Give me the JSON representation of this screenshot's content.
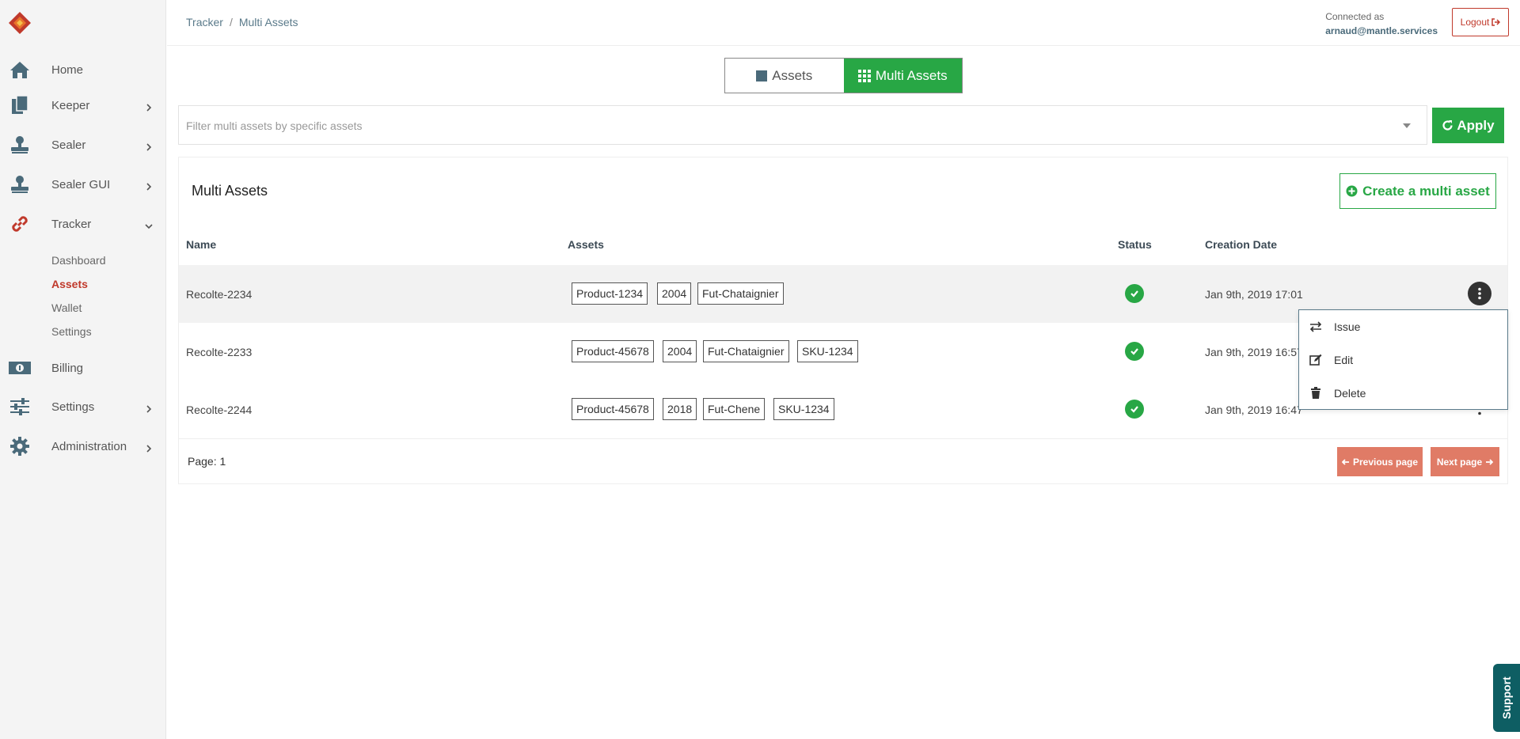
{
  "sidebar": {
    "logo": "mantle-logo",
    "items": [
      {
        "label": "Home",
        "icon": "home-icon"
      },
      {
        "label": "Keeper",
        "icon": "documents-icon"
      },
      {
        "label": "Sealer",
        "icon": "stamp-icon"
      },
      {
        "label": "Sealer GUI",
        "icon": "stamp-icon"
      },
      {
        "label": "Tracker",
        "icon": "link-icon"
      },
      {
        "label": "Billing",
        "icon": "money-icon"
      },
      {
        "label": "Settings",
        "icon": "sliders-icon"
      },
      {
        "label": "Administration",
        "icon": "gear-icon"
      }
    ],
    "tracker_sub": [
      "Dashboard",
      "Assets",
      "Wallet",
      "Settings"
    ],
    "active_sub": "Assets"
  },
  "header": {
    "breadcrumb": [
      "Tracker",
      "Multi Assets"
    ],
    "connected_as_label": "Connected as",
    "user": "arnaud@mantle.services",
    "logout_label": "Logout"
  },
  "toggle": {
    "assets_label": "Assets",
    "multi_label": "Multi Assets",
    "active": "Multi Assets"
  },
  "filter": {
    "placeholder": "Filter multi assets by specific assets",
    "apply_label": "Apply"
  },
  "panel": {
    "title": "Multi Assets",
    "create_label": "Create a multi asset",
    "columns": [
      "Name",
      "Assets",
      "Status",
      "Creation Date"
    ],
    "rows": [
      {
        "name": "Recolte-2234",
        "assets": [
          "Product-1234",
          "2004",
          "Fut-Chataignier"
        ],
        "status": "ok",
        "date": "Jan 9th, 2019 17:01"
      },
      {
        "name": "Recolte-2233",
        "assets": [
          "Product-45678",
          "2004",
          "Fut-Chataignier",
          "SKU-1234"
        ],
        "status": "ok",
        "date": "Jan 9th, 2019 16:57"
      },
      {
        "name": "Recolte-2244",
        "assets": [
          "Product-45678",
          "2018",
          "Fut-Chene",
          "SKU-1234"
        ],
        "status": "ok",
        "date": "Jan 9th, 2019 16:47"
      }
    ],
    "page_label": "Page:",
    "page_number": "1",
    "prev_label": "Previous page",
    "next_label": "Next page"
  },
  "menu": {
    "items": [
      {
        "label": "Issue",
        "icon": "exchange-icon"
      },
      {
        "label": "Edit",
        "icon": "edit-icon"
      },
      {
        "label": "Delete",
        "icon": "trash-icon"
      }
    ]
  },
  "support_label": "Support",
  "colors": {
    "accent": "#28a745",
    "danger": "#c0392b",
    "pager": "#e07b66",
    "support": "#0e5e63"
  }
}
